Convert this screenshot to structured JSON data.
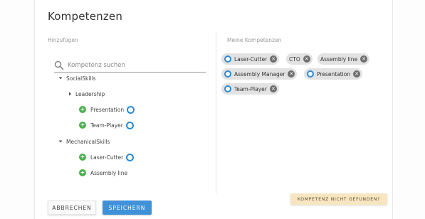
{
  "dialog": {
    "title": "Kompetenzen"
  },
  "left": {
    "label": "Hinzufügen",
    "search": {
      "placeholder": "Kompetenz suchen",
      "value": "",
      "icon": "search-icon"
    },
    "tree": [
      {
        "label": "SocialSkills",
        "type": "group",
        "expanded": true
      },
      {
        "label": "Leadership",
        "type": "group",
        "expanded": false
      },
      {
        "label": "Presentation",
        "type": "skill",
        "selected": true
      },
      {
        "label": "Team-Player",
        "type": "skill",
        "selected": true
      },
      {
        "label": "MechanicalSkills",
        "type": "group",
        "expanded": true
      },
      {
        "label": "Laser-Cutter",
        "type": "skill",
        "selected": true
      },
      {
        "label": "Assembly line",
        "type": "skill",
        "selected": false
      }
    ]
  },
  "right": {
    "label": "Meine Kompetenzen",
    "chips": [
      {
        "label": "Laser-Cutter",
        "has_ring": true
      },
      {
        "label": "CTO",
        "has_ring": false
      },
      {
        "label": "Assembly line",
        "has_ring": false
      },
      {
        "label": "Assembly Manager",
        "has_ring": true
      },
      {
        "label": "Presentation",
        "has_ring": true
      },
      {
        "label": "Team-Player",
        "has_ring": true
      }
    ]
  },
  "actions": {
    "cancel": "ABBRECHEN",
    "save": "SPEICHERN",
    "not_found": "KOMPETENZ NICHT GEFUNDEN?"
  },
  "colors": {
    "accent_blue": "#3f92d8",
    "add_green": "#4caf50",
    "chip_bg": "#e2e2e2",
    "warning_bg": "#f8e6c2"
  }
}
